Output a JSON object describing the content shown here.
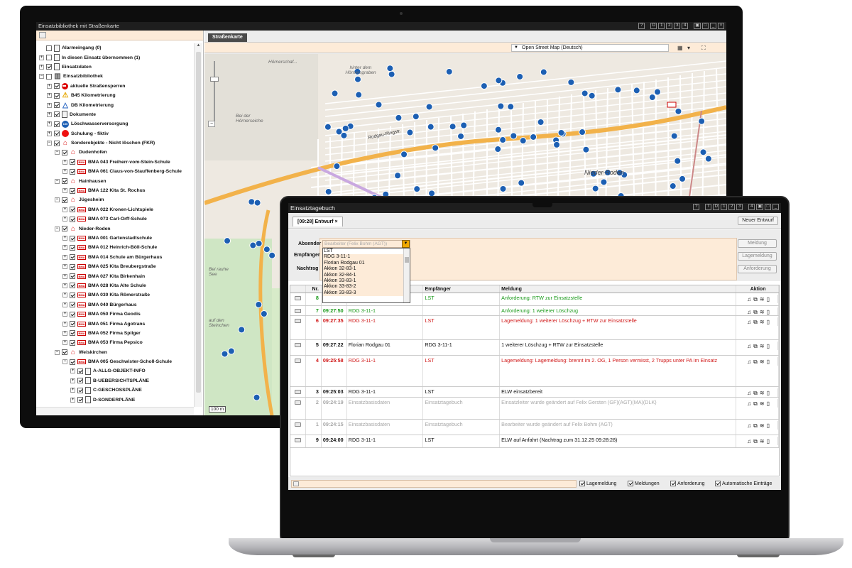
{
  "monitor": {
    "window_title": "Einsatzbibliothek mit Straßenkarte",
    "title_buttons": [
      "?",
      "D",
      "1",
      "2",
      "3",
      "4",
      "▣",
      "□",
      "_",
      "×"
    ],
    "tree": [
      {
        "depth": 1,
        "expand": "",
        "checked": false,
        "icon": "doc",
        "label": "Alarmeingang (0)"
      },
      {
        "depth": 1,
        "expand": "+",
        "checked": false,
        "icon": "doc",
        "label": "In diesen Einsatz übernommen (1)"
      },
      {
        "depth": 1,
        "expand": "+",
        "checked": true,
        "icon": "doc",
        "label": "Einsatzdaten"
      },
      {
        "depth": 1,
        "expand": "-",
        "checked": false,
        "icon": "lib",
        "label": "Einsatzbibliothek"
      },
      {
        "depth": 2,
        "expand": "+",
        "checked": true,
        "icon": "stop",
        "label": "aktuelle Straßensperren"
      },
      {
        "depth": 2,
        "expand": "+",
        "checked": true,
        "icon": "warn",
        "label": "B45 Kilometrierung"
      },
      {
        "depth": 2,
        "expand": "+",
        "checked": true,
        "icon": "tri",
        "label": "DB Kilometrierung"
      },
      {
        "depth": 2,
        "expand": "+",
        "checked": true,
        "icon": "doc",
        "label": "Dokumente"
      },
      {
        "depth": 2,
        "expand": "+",
        "checked": true,
        "icon": "blue",
        "label": "Löschwasserversorgung"
      },
      {
        "depth": 2,
        "expand": "+",
        "checked": true,
        "icon": "redc",
        "label": "Schulung - fiktiv"
      },
      {
        "depth": 2,
        "expand": "-",
        "checked": true,
        "icon": "house",
        "label": "Sonderobjekte - Nicht löschen (FKR)"
      },
      {
        "depth": 3,
        "expand": "-",
        "checked": true,
        "icon": "house",
        "label": "Dudenhofen"
      },
      {
        "depth": 4,
        "expand": "+",
        "checked": true,
        "icon": "bma",
        "label": "BMA 043 Freiherr-vom-Stein-Schule"
      },
      {
        "depth": 4,
        "expand": "+",
        "checked": true,
        "icon": "bma",
        "label": "BMA 061 Claus-von-Stauffenberg-Schule"
      },
      {
        "depth": 3,
        "expand": "-",
        "checked": true,
        "icon": "house",
        "label": "Hainhausen"
      },
      {
        "depth": 4,
        "expand": "+",
        "checked": true,
        "icon": "bma",
        "label": "BMA 122 Kita St. Rochus"
      },
      {
        "depth": 3,
        "expand": "-",
        "checked": true,
        "icon": "house",
        "label": "Jügesheim"
      },
      {
        "depth": 4,
        "expand": "+",
        "checked": true,
        "icon": "bma",
        "label": "BMA 022 Kronen-Lichtspiele"
      },
      {
        "depth": 4,
        "expand": "+",
        "checked": true,
        "icon": "bma",
        "label": "BMA 073 Carl-Orff-Schule"
      },
      {
        "depth": 3,
        "expand": "-",
        "checked": true,
        "icon": "house",
        "label": "Nieder-Roden"
      },
      {
        "depth": 4,
        "expand": "+",
        "checked": true,
        "icon": "bma",
        "label": "BMA 001 Gartenstadtschule"
      },
      {
        "depth": 4,
        "expand": "+",
        "checked": true,
        "icon": "bma",
        "label": "BMA 012 Heinrich-Böll-Schule"
      },
      {
        "depth": 4,
        "expand": "+",
        "checked": true,
        "icon": "bma",
        "label": "BMA 014 Schule am Bürgerhaus"
      },
      {
        "depth": 4,
        "expand": "+",
        "checked": true,
        "icon": "bma",
        "label": "BMA 025 Kita Breubergstraße"
      },
      {
        "depth": 4,
        "expand": "+",
        "checked": true,
        "icon": "bma",
        "label": "BMA 027 Kita Birkenhain"
      },
      {
        "depth": 4,
        "expand": "+",
        "checked": true,
        "icon": "bma",
        "label": "BMA 028 Kita Alte Schule"
      },
      {
        "depth": 4,
        "expand": "+",
        "checked": true,
        "icon": "bma",
        "label": "BMA 030 Kita Römerstraße"
      },
      {
        "depth": 4,
        "expand": "+",
        "checked": true,
        "icon": "bma",
        "label": "BMA 040 Bürgerhaus"
      },
      {
        "depth": 4,
        "expand": "+",
        "checked": true,
        "icon": "bma",
        "label": "BMA 050 Firma Geodis"
      },
      {
        "depth": 4,
        "expand": "+",
        "checked": true,
        "icon": "bma",
        "label": "BMA 051 Firma Agotrans"
      },
      {
        "depth": 4,
        "expand": "+",
        "checked": true,
        "icon": "bma",
        "label": "BMA 052 Firma Spilger"
      },
      {
        "depth": 4,
        "expand": "+",
        "checked": true,
        "icon": "bma",
        "label": "BMA 053 Firma Pepsico"
      },
      {
        "depth": 3,
        "expand": "-",
        "checked": true,
        "icon": "house",
        "label": "Weiskirchen"
      },
      {
        "depth": 4,
        "expand": "-",
        "checked": true,
        "icon": "bma",
        "label": "BMA 005 Geschwister-Scholl-Schule"
      },
      {
        "depth": 5,
        "expand": "+",
        "checked": true,
        "icon": "doc",
        "label": "A-ALLG-OBJEKT-INFO"
      },
      {
        "depth": 5,
        "expand": "+",
        "checked": true,
        "icon": "doc",
        "label": "B-UEBERSICHTSPLÄNE"
      },
      {
        "depth": 5,
        "expand": "+",
        "checked": true,
        "icon": "doc",
        "label": "C-GESCHOSSPLÄNE"
      },
      {
        "depth": 5,
        "expand": "+",
        "checked": true,
        "icon": "doc",
        "label": "D-SONDERPLÄNE"
      }
    ],
    "map_tab": "Straßenkarte",
    "map_layer": "Open Street Map (Deutsch)",
    "map_labels": [
      "Hörnerschaf...",
      "hinter dem Hörnersgraben",
      "Bei der Hörnerseiche",
      "Nieder-Roden",
      "Rodgau-Ringstr.",
      "Bei rauhe See",
      "auf den Steinchen"
    ],
    "zoom_text": "−",
    "scale": "100 m"
  },
  "laptop": {
    "window_title": "Einsatztagebuch",
    "title_buttons": [
      "?",
      "T",
      "D",
      "1",
      "2",
      "3",
      "4",
      "▣",
      "□",
      "_"
    ],
    "tab": "[09:28] Entwurf  ×",
    "new_button": "Neuer Entwurf",
    "labels": {
      "absender": "Absender",
      "empfaenger": "Empfänger",
      "nachtrag": "Nachtrag"
    },
    "absender_placeholder": "Bearbeiter (Felix Bohm (AGT))",
    "dropdown_options": [
      "LST",
      "RDG 3-11-1",
      "Florian Rodgau 01",
      "Akkon 32-83-1",
      "Akkon 32-84-1",
      "Akkon 33-83-1",
      "Akkon 33-83-2",
      "Akkon 33-83-3"
    ],
    "side_buttons": [
      "Meldung",
      "Lagemeldung",
      "Anforderung"
    ],
    "columns": [
      "",
      "Nr.",
      "",
      "",
      "Empfänger",
      "Meldung",
      "Aktion"
    ],
    "rows": [
      {
        "nr": "8",
        "time": "",
        "absender": "",
        "empfaenger": "LST",
        "meldung": "Anforderung: RTW zur Einsatzstelle",
        "color": "green",
        "h": 18
      },
      {
        "nr": "7",
        "time": "09:27:50",
        "absender": "RDG 3-11-1",
        "empfaenger": "",
        "meldung": "Anforderung: 1 weiterer Löschzug",
        "color": "green",
        "h": 14
      },
      {
        "nr": "6",
        "time": "09:27:35",
        "absender": "RDG 3-11-1",
        "empfaenger": "LST",
        "meldung": "Lagemeldung: 1 weiterer Löschzug + RTW zur Einsatzstelle",
        "color": "red",
        "h": 34
      },
      {
        "nr": "5",
        "time": "09:27:22",
        "absender": "Florian Rodgau 01",
        "empfaenger": "RDG 3-11-1",
        "meldung": "1 weiterer Löschzug + RTW zur Einsatzstelle",
        "color": "black",
        "h": 22
      },
      {
        "nr": "4",
        "time": "09:25:58",
        "absender": "RDG 3-11-1",
        "empfaenger": "LST",
        "meldung": "Lagemeldung: Lagemeldung: brennt im 2. OG, 1 Person vermisst, 2 Trupps unter PA im Einsatz",
        "color": "red",
        "h": 44
      },
      {
        "nr": "3",
        "time": "09:25:03",
        "absender": "RDG 3-11-1",
        "empfaenger": "LST",
        "meldung": "ELW einsatzbereit",
        "color": "black",
        "h": 15
      },
      {
        "nr": "2",
        "time": "09:24:19",
        "absender": "Einsatzbasisdaten",
        "empfaenger": "Einsatztagebuch",
        "meldung": "Einsatzleiter wurde geändert auf Felix Gersten (GF)(AGT)(MA)(DLK)",
        "color": "grey",
        "h": 31
      },
      {
        "nr": "1",
        "time": "09:24:15",
        "absender": "Einsatzbasisdaten",
        "empfaenger": "Einsatztagebuch",
        "meldung": "Bearbeiter wurde geändert auf Felix Bohm (AGT)",
        "color": "grey",
        "h": 22
      },
      {
        "nr": "9",
        "time": "09:24:00",
        "absender": "RDG 3-11-1",
        "empfaenger": "LST",
        "meldung": "ELW auf Anfahrt (Nachtrag zum 31.12.25 09:28:28)",
        "color": "black",
        "h": 18
      }
    ],
    "action_icons": [
      "bell-icon",
      "copy-icon",
      "filter-icon",
      "delete-icon"
    ],
    "filters": [
      "Lagemeldung",
      "Meldungen",
      "Anforderung",
      "Automatische Einträge"
    ]
  },
  "colors": {
    "accent_input": "#fdebd8",
    "green": "#1a9a1a",
    "red": "#d01818",
    "grey": "#a8a8a8",
    "dropdown_arrow": "#f0a800"
  }
}
